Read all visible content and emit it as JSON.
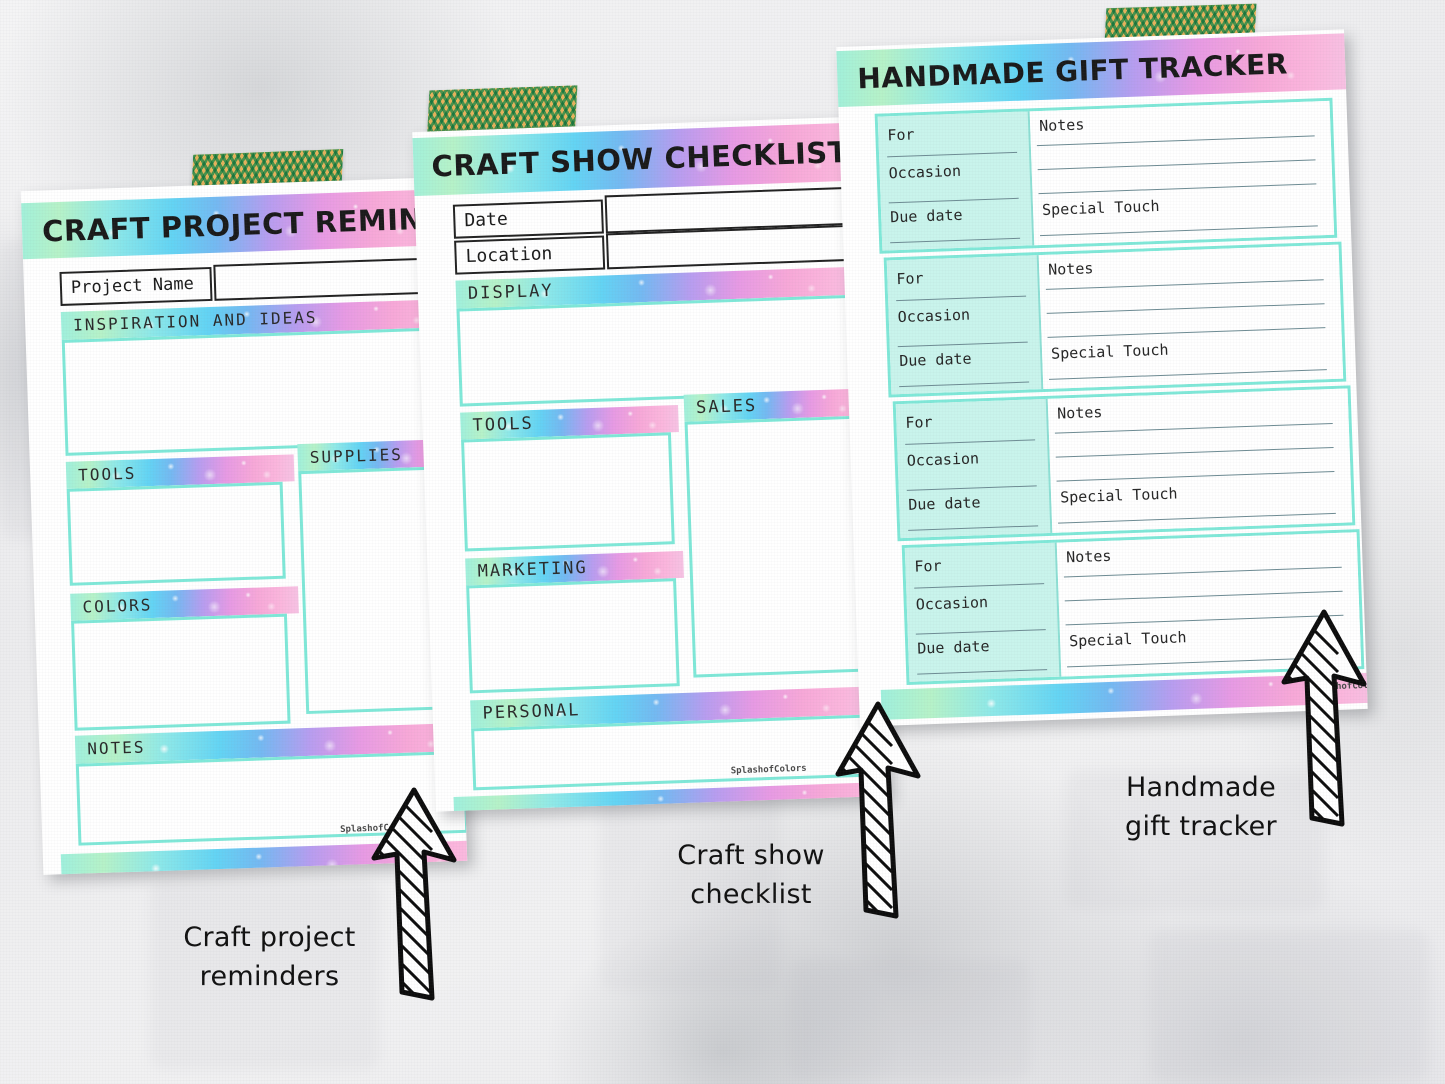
{
  "page": {
    "watermark": "SplashofColors"
  },
  "sheets": [
    {
      "id": "craft-project-reminders",
      "title": "CRAFT PROJECT REMINDERS",
      "fields": [
        {
          "label": "Project Name"
        }
      ],
      "sections": [
        {
          "label": "INSPIRATION AND IDEAS"
        },
        {
          "label": "TOOLS"
        },
        {
          "label": "SUPPLIES"
        },
        {
          "label": "COLORS"
        },
        {
          "label": "NOTES"
        }
      ]
    },
    {
      "id": "craft-show-checklist",
      "title": "CRAFT SHOW CHECKLIST",
      "fields": [
        {
          "label": "Date"
        },
        {
          "label": "Location"
        }
      ],
      "sections": [
        {
          "label": "DISPLAY"
        },
        {
          "label": "TOOLS"
        },
        {
          "label": "SALES"
        },
        {
          "label": "MARKETING"
        },
        {
          "label": "PERSONAL"
        }
      ]
    },
    {
      "id": "handmade-gift-tracker",
      "title": "HANDMADE GIFT TRACKER",
      "card_labels": {
        "for": "For",
        "occasion": "Occasion",
        "due_date": "Due date",
        "notes": "Notes",
        "special_touch": "Special Touch"
      },
      "cards": [
        {
          "for": "For",
          "occasion": "Occasion",
          "due_date": "Due date",
          "notes": "Notes",
          "special_touch": "Special Touch"
        },
        {
          "for": "For",
          "occasion": "Occasion",
          "due_date": "Due date",
          "notes": "Notes",
          "special_touch": "Special Touch"
        },
        {
          "for": "For",
          "occasion": "Occasion",
          "due_date": "Due date",
          "notes": "Notes",
          "special_touch": "Special Touch"
        },
        {
          "for": "For",
          "occasion": "Occasion",
          "due_date": "Due date",
          "notes": "Notes",
          "special_touch": "Special Touch"
        }
      ]
    }
  ],
  "annotations": [
    {
      "id": "anno-craft-project-reminders",
      "text": "Craft project\nreminders"
    },
    {
      "id": "anno-craft-show-checklist",
      "text": "Craft show\nchecklist"
    },
    {
      "id": "anno-handmade-gift-tracker",
      "text": "Handmade\ngift tracker"
    }
  ],
  "colors": {
    "mint_border": "#7fe8d8",
    "mint_fill": "#c9f4ec",
    "gradient_start": "#9ff0dd",
    "gradient_mid": "#74b9f2",
    "gradient_end": "#f6c3e4",
    "tape_green": "#49b892",
    "tape_cream": "#f7e3b5",
    "background": "#eeeeee"
  }
}
